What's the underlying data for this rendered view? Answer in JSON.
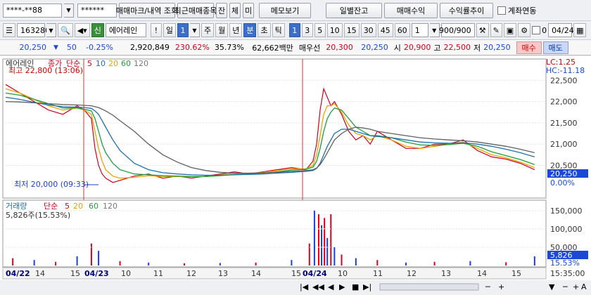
{
  "toolbar1": {
    "account": "****-**88",
    "password": "******",
    "btn_order_marks": "매매마크/내역 조회",
    "btn_recent_items": "최근매매종목",
    "btn_jan": "잔",
    "btn_che": "체",
    "btn_mi": "미",
    "btn_memo": "메모보기",
    "btn_daily_balance": "일별잔고",
    "btn_trade_profit": "매매수익",
    "btn_return_trend": "수익률추이",
    "account_link_label": "계좌연동"
  },
  "toolbar2": {
    "stock_code": "163280",
    "market_tag": "신",
    "stock_name": "에어레인",
    "period_il": "일",
    "period_value": "1",
    "periods": [
      "주",
      "월",
      "년"
    ],
    "period_min": "분",
    "period_cho": "초",
    "period_tick": "틱",
    "intervals": [
      "1",
      "3",
      "5",
      "10",
      "15",
      "30",
      "45",
      "60"
    ],
    "interval_value": "1",
    "count": "900/900",
    "date": "04/24",
    "zero_label": "0"
  },
  "quote": {
    "price": "20,250",
    "arrow": "▼",
    "change": "50",
    "change_pct": "-0.25%",
    "volume": "2,920,849",
    "vol_ratio": "230.62%",
    "turnover": "35.73%",
    "amount": "62,662백만",
    "pref_label": "매우선",
    "pref_value": "20,300",
    "sell_value": "20,250",
    "open_label": "시",
    "open_value": "20,900",
    "high_label": "고",
    "high_value": "22,500",
    "low_label": "저",
    "low_value": "20,250",
    "buy_btn": "매수",
    "sell_btn": "매도"
  },
  "price_panel": {
    "stock_name": "에어레인",
    "line_type": "종가",
    "ma_type": "단순",
    "ma_periods": [
      "5",
      "10",
      "20",
      "60",
      "120"
    ],
    "high_note": "최고 22,800 (13:06)",
    "low_note": "최저 20,000 (09:33)",
    "lc": "LC:1.25",
    "hc": "HC:-11.18",
    "y_ticks": [
      "22,500",
      "22,000",
      "21,500",
      "21,000",
      "20,500"
    ],
    "current_tag": "20,250",
    "pct_tag": "0.00%"
  },
  "volume_panel": {
    "label": "거래량",
    "ma_type": "단순",
    "ma_periods": [
      "5",
      "20",
      "60",
      "120"
    ],
    "current_line": "5,826주(15.53%)",
    "y_ticks": [
      "150,000",
      "100,000",
      "50,000"
    ],
    "current_tag": "5,826",
    "pct_tag": "15.53%"
  },
  "x_axis": {
    "labels": [
      "04/22",
      "14",
      "15",
      "04/23",
      "10",
      "11",
      "12",
      "13",
      "14",
      "15",
      "04/24",
      "10",
      "11",
      "12",
      "13",
      "14",
      "15"
    ],
    "time": "15:35:00"
  },
  "chart_data": {
    "type": "line",
    "title": "",
    "xlabel": "",
    "ylabel": "",
    "ylim": [
      19800,
      22900
    ],
    "x": [
      0,
      20,
      40,
      60,
      80,
      100,
      110,
      120,
      125,
      130,
      135,
      140,
      150,
      160,
      180,
      200,
      220,
      240,
      260,
      280,
      300,
      320,
      340,
      360,
      380,
      400,
      420,
      430,
      435,
      440,
      445,
      450,
      455,
      460,
      470,
      480,
      490,
      500,
      510,
      520,
      540,
      560,
      580,
      600,
      620,
      640,
      660,
      680,
      700,
      720,
      740
    ],
    "series": [
      {
        "values": [
          22400,
          22200,
          22000,
          21800,
          21700,
          21900,
          21800,
          21600,
          20900,
          20500,
          20300,
          20200,
          20100,
          20150,
          20250,
          20300,
          20200,
          20250,
          20200,
          20250,
          20300,
          20350,
          20300,
          20350,
          20400,
          20450,
          20400,
          20600,
          21000,
          21800,
          22300,
          22100,
          21900,
          22000,
          21700,
          21300,
          21100,
          21200,
          21000,
          21300,
          21100,
          20900,
          20900,
          21000,
          21000,
          21100,
          20850,
          20700,
          20650,
          20550,
          20400
        ]
      },
      {
        "values": [
          22300,
          22200,
          22050,
          21900,
          21800,
          21850,
          21800,
          21700,
          21300,
          20900,
          20600,
          20400,
          20250,
          20200,
          20220,
          20260,
          20240,
          20240,
          20230,
          20240,
          20280,
          20320,
          20310,
          20340,
          20380,
          20420,
          20420,
          20500,
          20750,
          21200,
          21700,
          21900,
          21900,
          21950,
          21750,
          21450,
          21250,
          21200,
          21100,
          21200,
          21100,
          20950,
          20900,
          20950,
          21000,
          21050,
          20900,
          20750,
          20680,
          20580,
          20450
        ]
      },
      {
        "values": [
          22200,
          22150,
          22050,
          21950,
          21850,
          21850,
          21820,
          21780,
          21600,
          21300,
          21000,
          20800,
          20550,
          20400,
          20300,
          20280,
          20260,
          20250,
          20240,
          20240,
          20260,
          20290,
          20300,
          20320,
          20350,
          20390,
          20410,
          20460,
          20600,
          20900,
          21300,
          21600,
          21750,
          21850,
          21800,
          21600,
          21400,
          21300,
          21200,
          21200,
          21150,
          21050,
          20980,
          20970,
          20990,
          21020,
          20950,
          20820,
          20730,
          20640,
          20520
        ]
      },
      {
        "values": [
          22100,
          22050,
          21980,
          21920,
          21880,
          21870,
          21860,
          21840,
          21780,
          21700,
          21550,
          21400,
          21100,
          20850,
          20550,
          20400,
          20330,
          20300,
          20280,
          20270,
          20270,
          20280,
          20290,
          20300,
          20320,
          20340,
          20360,
          20380,
          20430,
          20550,
          20750,
          20950,
          21100,
          21250,
          21350,
          21350,
          21300,
          21250,
          21200,
          21180,
          21150,
          21100,
          21050,
          21030,
          21020,
          21030,
          21000,
          20950,
          20880,
          20800,
          20700
        ]
      },
      {
        "values": [
          22000,
          21990,
          21970,
          21950,
          21930,
          21920,
          21910,
          21900,
          21880,
          21860,
          21820,
          21780,
          21680,
          21550,
          21300,
          21000,
          20750,
          20580,
          20450,
          20380,
          20340,
          20320,
          20320,
          20330,
          20340,
          20360,
          20380,
          20400,
          20440,
          20520,
          20650,
          20800,
          20950,
          21100,
          21250,
          21350,
          21400,
          21380,
          21350,
          21300,
          21250,
          21200,
          21150,
          21120,
          21100,
          21080,
          21050,
          21000,
          20950,
          20880,
          20800
        ]
      }
    ],
    "volume": {
      "ylim": [
        0,
        165000
      ],
      "x": [
        10,
        40,
        70,
        100,
        120,
        130,
        160,
        200,
        250,
        300,
        350,
        400,
        425,
        432,
        438,
        442,
        446,
        450,
        455,
        460,
        470,
        490,
        520,
        560,
        600,
        650,
        700,
        740
      ],
      "values": [
        20000,
        15000,
        10000,
        25000,
        60000,
        40000,
        12000,
        8000,
        6000,
        7000,
        8000,
        15000,
        60000,
        150000,
        140000,
        110000,
        130000,
        75000,
        140000,
        50000,
        30000,
        20000,
        15000,
        8000,
        10000,
        12000,
        9000,
        25000
      ]
    }
  },
  "colors": {
    "series": [
      "#d0001b",
      "#e5a400",
      "#1e9d3c",
      "#1e6fb0",
      "#606060"
    ],
    "up": "#e0001b",
    "down": "#1b3fd6",
    "buy_bg": "#f7c8c8",
    "sell_bg": "#c8d8f7"
  }
}
